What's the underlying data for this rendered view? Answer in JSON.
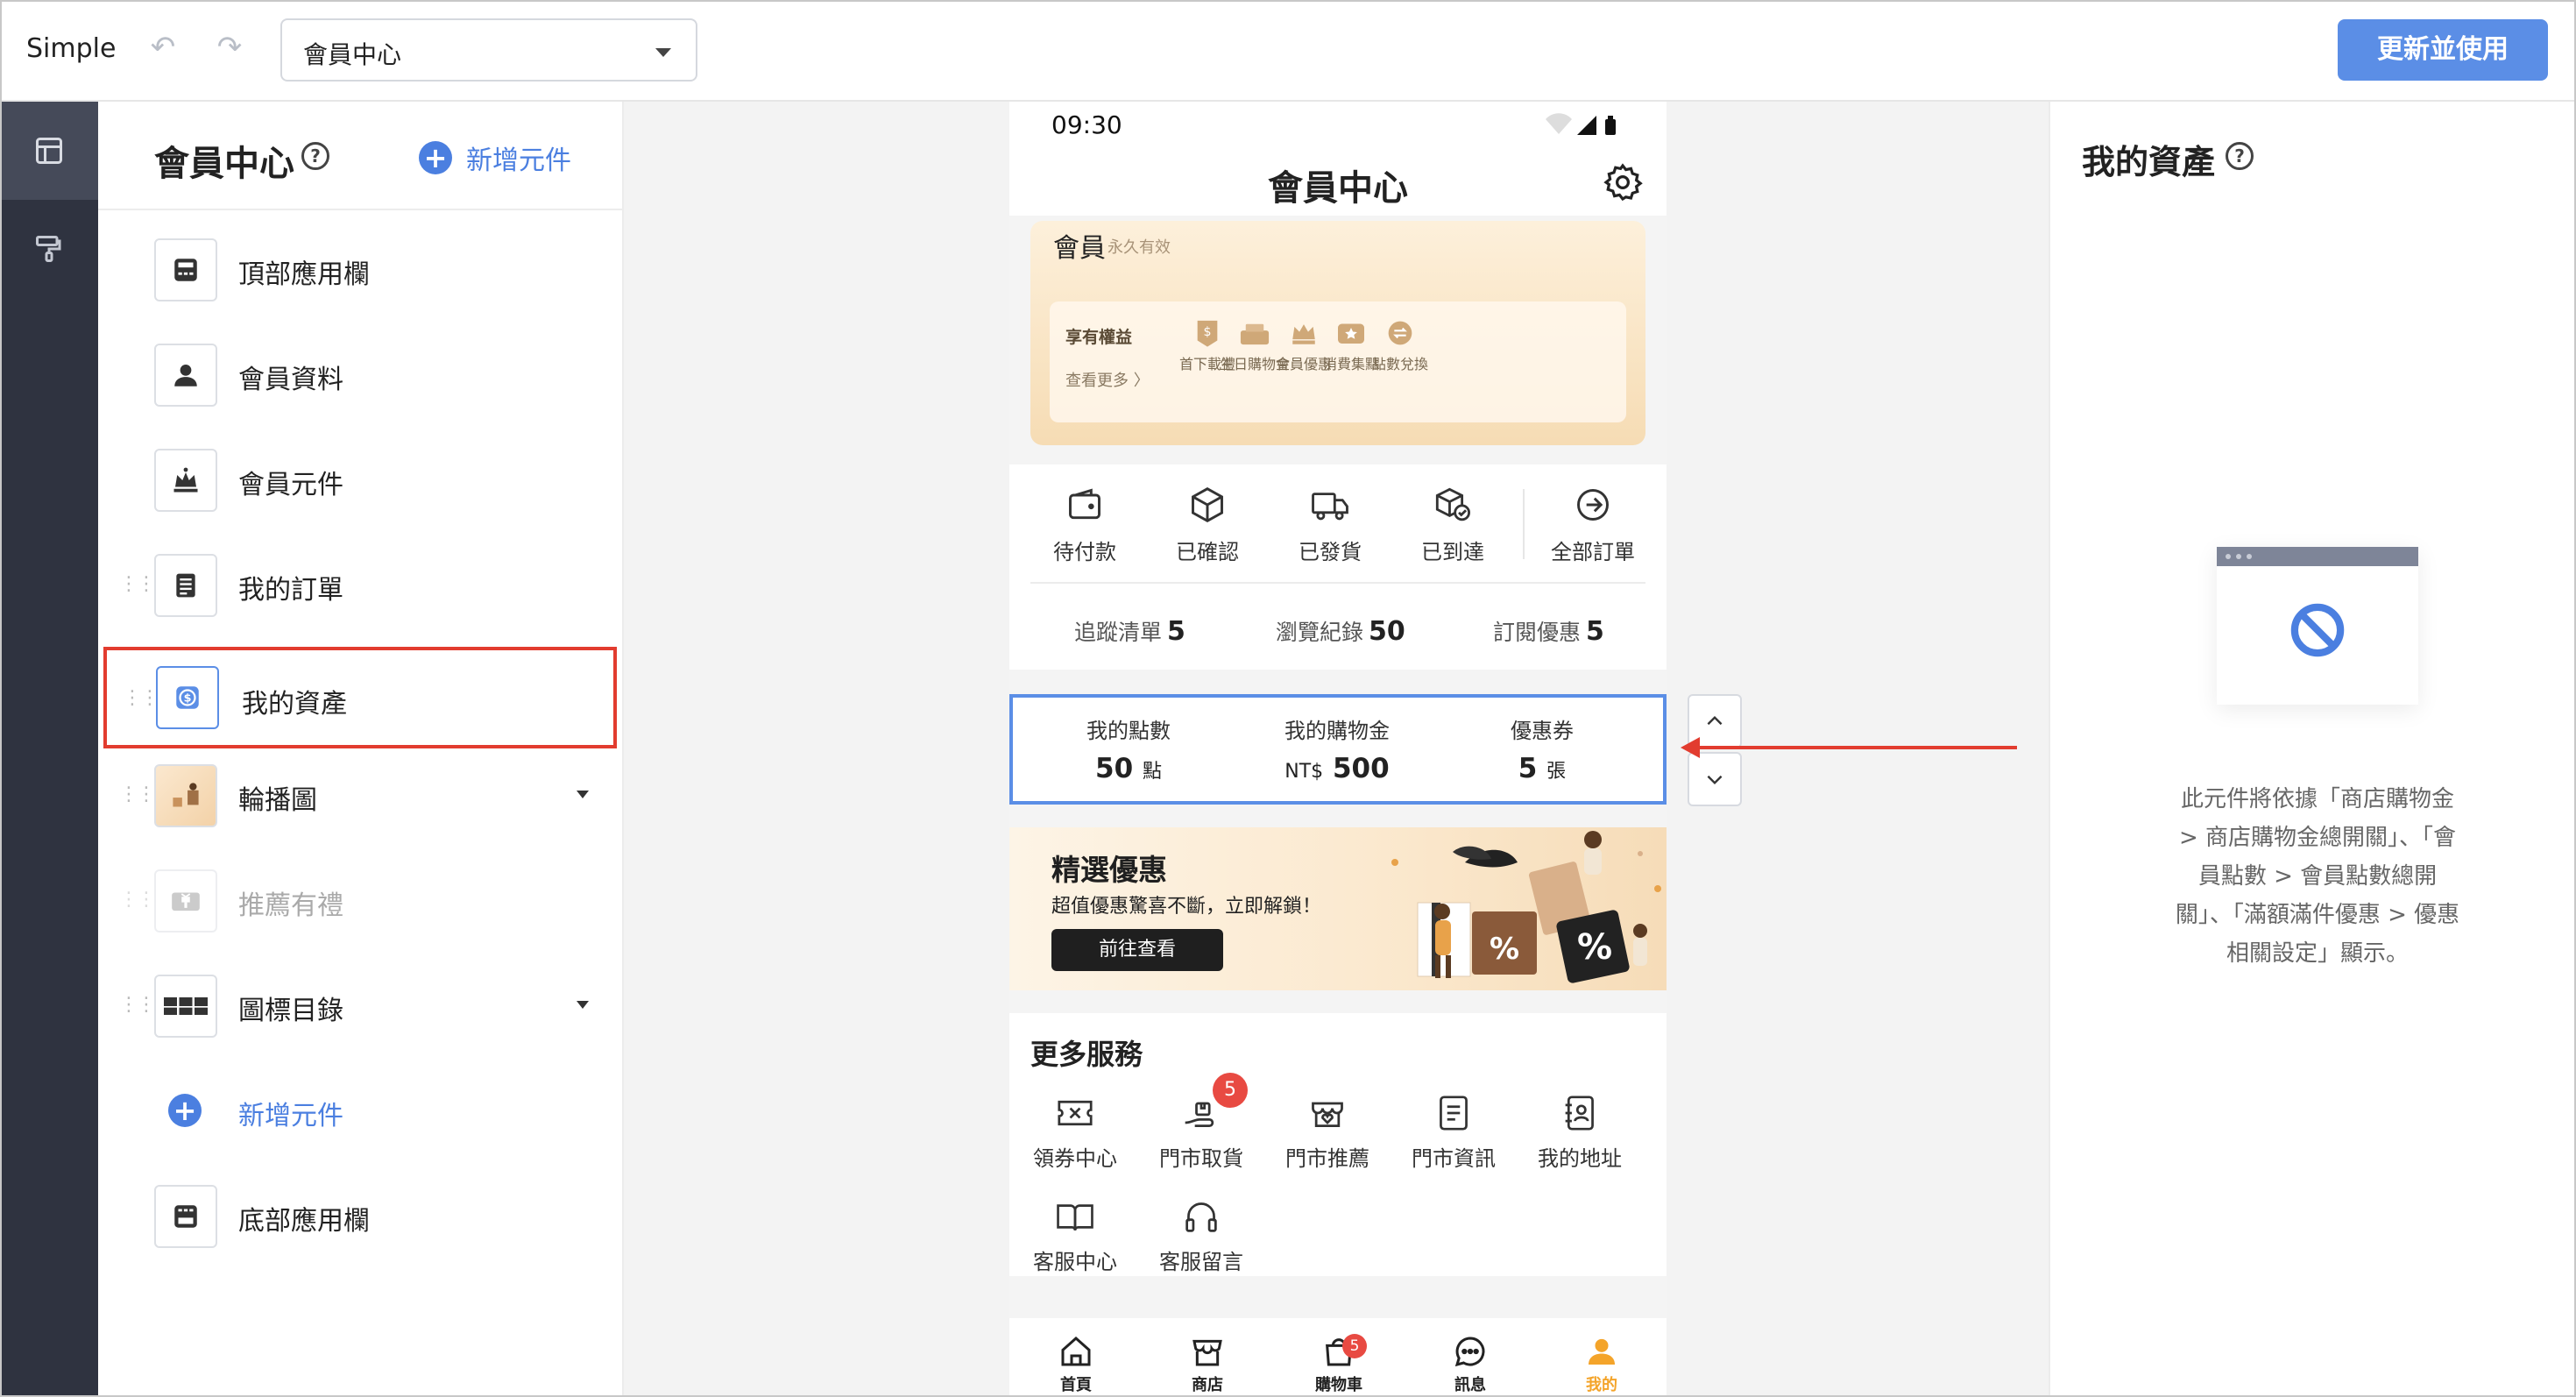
{
  "app": {
    "brand": "Simple",
    "page_select": "會員中心",
    "publish_label": "更新並使用"
  },
  "left_panel": {
    "title": "會員中心",
    "add_label": "新增元件",
    "components": [
      {
        "label": "頂部應用欄",
        "icon": "top-bar-icon"
      },
      {
        "label": "會員資料",
        "icon": "person-icon"
      },
      {
        "label": "會員元件",
        "icon": "crown-icon"
      },
      {
        "label": "我的訂單",
        "icon": "order-list-icon"
      },
      {
        "label": "我的資產",
        "icon": "dollar-icon",
        "selected": true
      },
      {
        "label": "輪播圖",
        "icon": "image-thumbnail-icon"
      },
      {
        "label": "推薦有禮",
        "icon": "gift-icon",
        "disabled": true
      },
      {
        "label": "圖標目錄",
        "icon": "icon-grid-icon"
      }
    ],
    "add_bottom_label": "新增元件",
    "bottom_bar_label": "底部應用欄"
  },
  "phone": {
    "time": "09:30",
    "title": "會員中心",
    "member_card": {
      "title": "會員",
      "subtitle": "永久有效",
      "benefits_title": "享有權益",
      "more": "查看更多 〉",
      "items": [
        "首下載禮",
        "生日購物金",
        "會員優惠",
        "消費集點",
        "點數兌換"
      ]
    },
    "orders": {
      "items": [
        "待付款",
        "已確認",
        "已發貨",
        "已到達",
        "全部訂單"
      ],
      "stats": [
        {
          "label": "追蹤清單",
          "value": "5"
        },
        {
          "label": "瀏覽紀錄",
          "value": "50"
        },
        {
          "label": "訂閱優惠",
          "value": "5"
        }
      ]
    },
    "assets": [
      {
        "label": "我的點數",
        "value": "50",
        "unit": "點",
        "prefix": ""
      },
      {
        "label": "我的購物金",
        "value": "500",
        "unit": "",
        "prefix": "NT$"
      },
      {
        "label": "優惠券",
        "value": "5",
        "unit": "張",
        "prefix": ""
      }
    ],
    "promo": {
      "title": "精選優惠",
      "subtitle": "超值優惠驚喜不斷，立即解鎖！",
      "button": "前往查看"
    },
    "services": {
      "title": "更多服務",
      "items": [
        {
          "label": "領券中心",
          "icon": "coupon-icon"
        },
        {
          "label": "門市取貨",
          "icon": "pickup-icon",
          "badge": "5"
        },
        {
          "label": "門市推薦",
          "icon": "store-heart-icon"
        },
        {
          "label": "門市資訊",
          "icon": "document-icon"
        },
        {
          "label": "我的地址",
          "icon": "address-book-icon"
        },
        {
          "label": "客服中心",
          "icon": "book-icon"
        },
        {
          "label": "客服留言",
          "icon": "headset-icon"
        }
      ]
    },
    "tabs": [
      {
        "label": "首頁",
        "icon": "home-icon"
      },
      {
        "label": "商店",
        "icon": "store-icon"
      },
      {
        "label": "購物車",
        "icon": "cart-icon",
        "badge": "5"
      },
      {
        "label": "訊息",
        "icon": "chat-icon"
      },
      {
        "label": "我的",
        "icon": "user-icon",
        "active": true
      }
    ]
  },
  "right_panel": {
    "title": "我的資產",
    "description": "此元件將依據「商店購物金 > 商店購物金總開關」、「會員點數 > 會員點數總開關」、「滿額滿件優惠 > 優惠相關設定」顯示。"
  },
  "colors": {
    "accent": "#5b8ee6",
    "highlight": "#e23c2f",
    "rail": "#2f3340",
    "active_tab": "#f4a42a",
    "badge": "#e84a42"
  }
}
